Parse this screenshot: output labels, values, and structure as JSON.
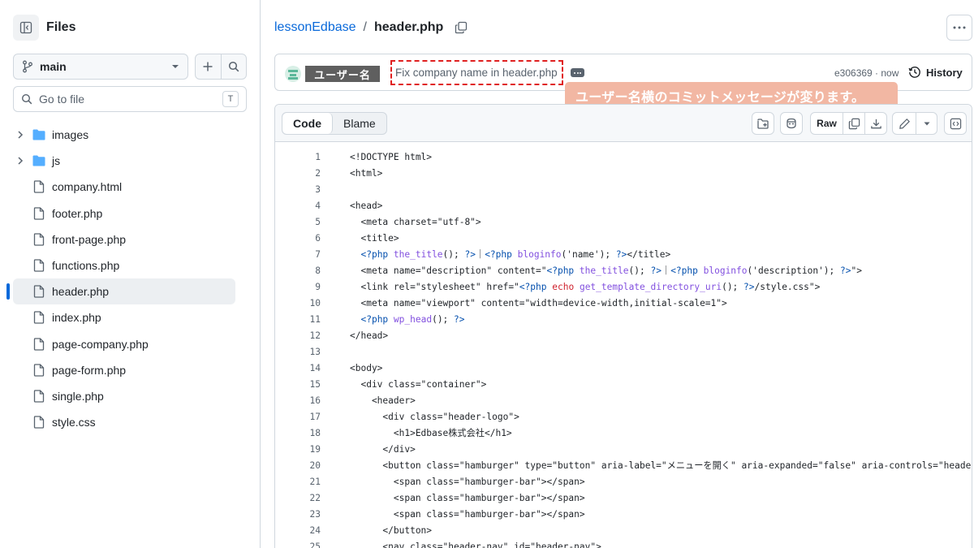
{
  "sidebar": {
    "title": "Files",
    "branch": "main",
    "search_placeholder": "Go to file",
    "search_shortcut": "T",
    "items": [
      {
        "name": "images",
        "type": "folder"
      },
      {
        "name": "js",
        "type": "folder"
      },
      {
        "name": "company.html",
        "type": "file"
      },
      {
        "name": "footer.php",
        "type": "file"
      },
      {
        "name": "front-page.php",
        "type": "file"
      },
      {
        "name": "functions.php",
        "type": "file"
      },
      {
        "name": "header.php",
        "type": "file",
        "active": true
      },
      {
        "name": "index.php",
        "type": "file"
      },
      {
        "name": "page-company.php",
        "type": "file"
      },
      {
        "name": "page-form.php",
        "type": "file"
      },
      {
        "name": "single.php",
        "type": "file"
      },
      {
        "name": "style.css",
        "type": "file"
      }
    ]
  },
  "breadcrumb": {
    "repo": "lessonEdbase",
    "separator": "/",
    "file": "header.php"
  },
  "commit": {
    "user": "ユーザー名",
    "message": "Fix company name in header.php",
    "sha_time": "e306369 · now",
    "history_label": "History"
  },
  "callout": {
    "text": "ユーザー名横のコミットメッセージが変ります。"
  },
  "code_view": {
    "tabs": [
      "Code",
      "Blame"
    ],
    "active_tab": "Code",
    "raw_label": "Raw"
  },
  "code_lines": [
    "<!DOCTYPE html>",
    "<html>",
    "",
    "<head>",
    "  <meta charset=\"utf-8\">",
    "  <title>",
    "  <?php the_title(); ?>｜<?php bloginfo('name'); ?></title>",
    "  <meta name=\"description\" content=\"<?php the_title(); ?>｜<?php bloginfo('description'); ?>\">",
    "  <link rel=\"stylesheet\" href=\"<?php echo get_template_directory_uri(); ?>/style.css\">",
    "  <meta name=\"viewport\" content=\"width=device-width,initial-scale=1\">",
    "  <?php wp_head(); ?>",
    "</head>",
    "",
    "<body>",
    "  <div class=\"container\">",
    "    <header>",
    "      <div class=\"header-logo\">",
    "        <h1>Edbase株式会社</h1>",
    "      </div>",
    "      <button class=\"hamburger\" type=\"button\" aria-label=\"メニューを開く\" aria-expanded=\"false\" aria-controls=\"header-nav\">",
    "        <span class=\"hamburger-bar\"></span>",
    "        <span class=\"hamburger-bar\"></span>",
    "        <span class=\"hamburger-bar\"></span>",
    "      </button>",
    "      <nav class=\"header-nav\" id=\"header-nav\">"
  ],
  "colors": {
    "link": "#0969da",
    "border": "#d0d7de",
    "dashed_highlight": "#e02020",
    "callout_bg": "#f2b7a3",
    "user_tag_bg": "#5f5f5f",
    "php_keyword": "#0550ae",
    "php_function": "#8250df"
  }
}
